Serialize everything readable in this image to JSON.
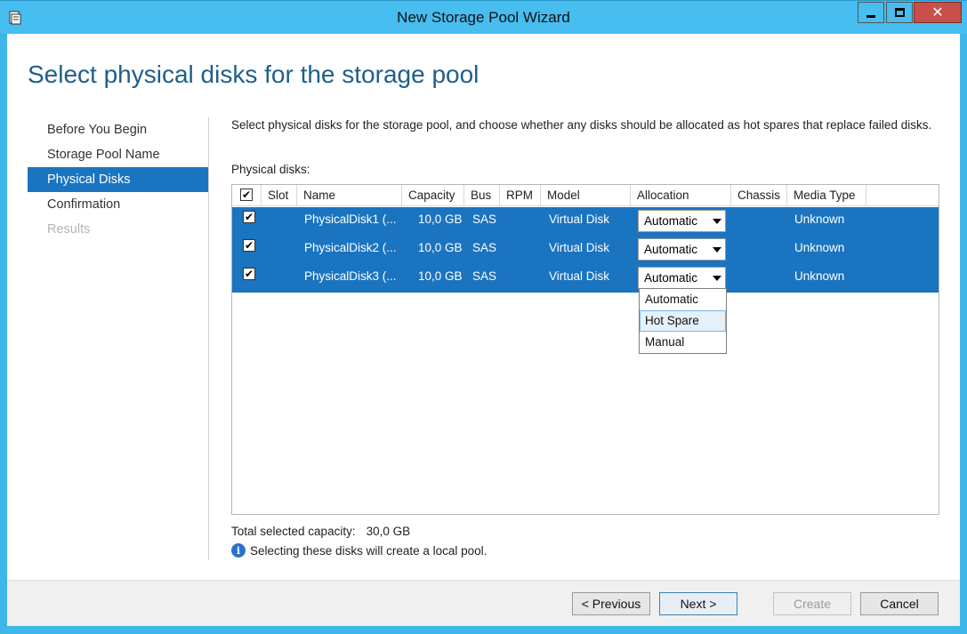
{
  "window": {
    "title": "New Storage Pool Wizard",
    "icons": {
      "app": "storage-pool-icon",
      "minimize": "minimize-icon",
      "maximize": "maximize-icon",
      "close": "close-icon"
    },
    "accent": "#3fb6e8",
    "close_color": "#c7504b"
  },
  "page": {
    "heading": "Select physical disks for the storage pool",
    "description": "Select physical disks for the storage pool, and choose whether any disks should be allocated as hot spares that replace failed disks.",
    "physical_disks_label": "Physical disks:",
    "total_label": "Total selected capacity:",
    "total_value": "30,0 GB",
    "info_text": "Selecting these disks will create a local pool.",
    "info_icon": "info-icon"
  },
  "nav": {
    "items": [
      {
        "label": "Before You Begin",
        "state": "normal"
      },
      {
        "label": "Storage Pool Name",
        "state": "normal"
      },
      {
        "label": "Physical Disks",
        "state": "active"
      },
      {
        "label": "Confirmation",
        "state": "normal"
      },
      {
        "label": "Results",
        "state": "disabled"
      }
    ],
    "active_color": "#1b74c0"
  },
  "table": {
    "columns": [
      "Slot",
      "Name",
      "Capacity",
      "Bus",
      "RPM",
      "Model",
      "Allocation",
      "Chassis",
      "Media Type"
    ],
    "header_checked": true,
    "rows": [
      {
        "checked": true,
        "slot": "",
        "name": "PhysicalDisk1 (...",
        "capacity": "10,0 GB",
        "bus": "SAS",
        "rpm": "",
        "model": "Virtual Disk",
        "allocation": "Automatic",
        "chassis": "",
        "media_type": "Unknown"
      },
      {
        "checked": true,
        "slot": "",
        "name": "PhysicalDisk2 (...",
        "capacity": "10,0 GB",
        "bus": "SAS",
        "rpm": "",
        "model": "Virtual Disk",
        "allocation": "Automatic",
        "chassis": "",
        "media_type": "Unknown"
      },
      {
        "checked": true,
        "slot": "",
        "name": "PhysicalDisk3 (...",
        "capacity": "10,0 GB",
        "bus": "SAS",
        "rpm": "",
        "model": "Virtual Disk",
        "allocation": "Automatic",
        "chassis": "",
        "media_type": "Unknown"
      }
    ],
    "selection_color": "#1b74c0"
  },
  "dropdown": {
    "options": [
      "Automatic",
      "Hot Spare",
      "Manual"
    ],
    "highlighted": "Hot Spare"
  },
  "buttons": {
    "previous": "< Previous",
    "next": "Next >",
    "create": "Create",
    "cancel": "Cancel"
  }
}
